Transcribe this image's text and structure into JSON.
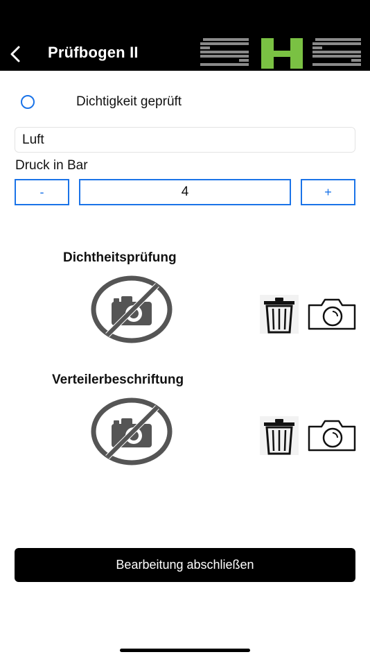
{
  "header": {
    "title": "Prüfbogen II",
    "logo_text": "SHS"
  },
  "check": {
    "label": "Dichtigkeit geprüft",
    "checked": false
  },
  "medium_field": {
    "value": "Luft"
  },
  "pressure": {
    "label": "Druck in Bar",
    "decrement_label": "-",
    "value": "4",
    "increment_label": "+"
  },
  "photo_sections": [
    {
      "title": "Dichtheitsprüfung",
      "photo_state": "no-photo-icon",
      "actions": [
        "trash-icon",
        "camera-icon"
      ]
    },
    {
      "title": "Verteilerbeschriftung",
      "photo_state": "no-photo-icon",
      "actions": [
        "trash-icon",
        "camera-icon"
      ]
    }
  ],
  "submit": {
    "label": "Bearbeitung abschließen"
  },
  "colors": {
    "accent": "#1a73e8",
    "header_bg": "#000000",
    "logo_green": "#7ac143",
    "logo_gray": "#8a8a8a"
  }
}
